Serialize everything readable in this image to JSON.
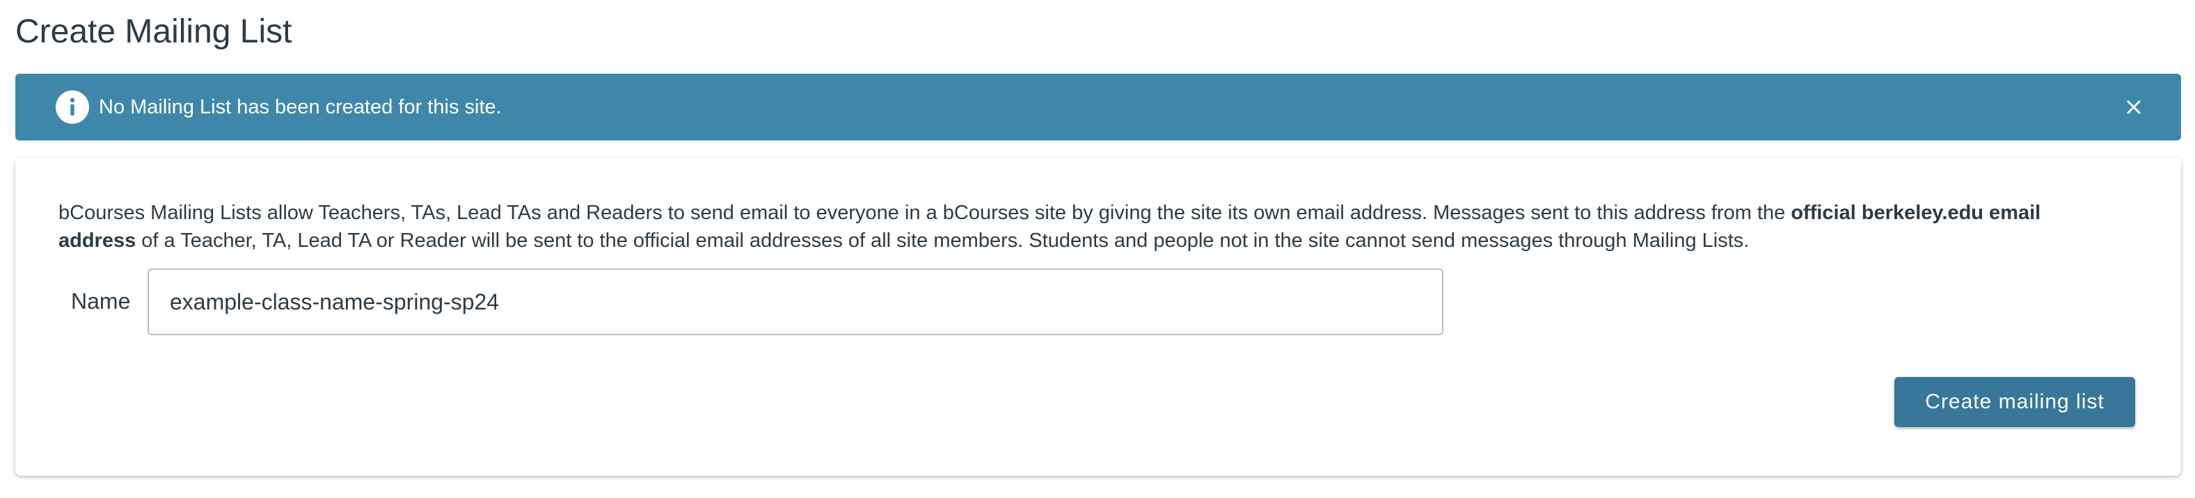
{
  "page": {
    "title": "Create Mailing List"
  },
  "alert": {
    "icon": "info-icon",
    "message": "No Mailing List has been created for this site.",
    "close_icon": "close-icon",
    "background_color": "#3f87aa"
  },
  "card": {
    "description_part1": "bCourses Mailing Lists allow Teachers, TAs, Lead TAs and Readers to send email to everyone in a bCourses site by giving the site its own email address. Messages sent to this address from the ",
    "description_bold": "official berkeley.edu email address",
    "description_part2": " of a Teacher, TA, Lead TA or Reader will be sent to the official email addresses of all site members. Students and people not in the site cannot send messages through Mailing Lists.",
    "name_label": "Name",
    "name_value": "example-class-name-spring-sp24",
    "create_button_label": "Create mailing list",
    "button_color": "#38769a"
  }
}
